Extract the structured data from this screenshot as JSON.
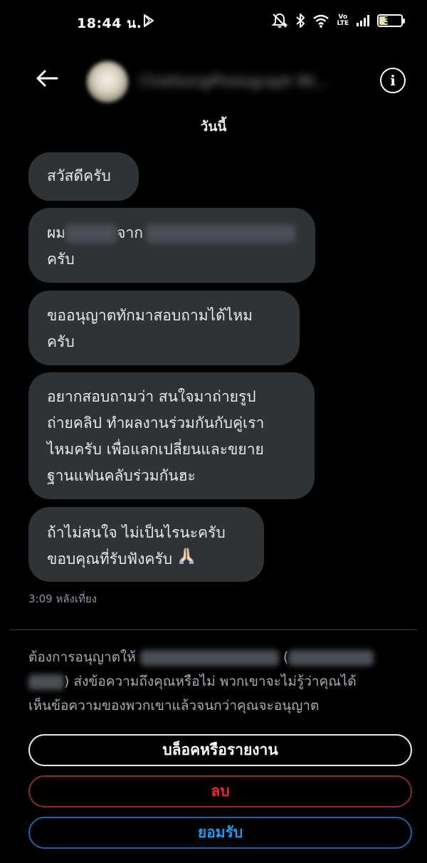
{
  "status_bar": {
    "time": "18:44 น.",
    "volte_top": "Vo",
    "volte_bottom": "LTE",
    "battery_percent": "37",
    "battery_level": 0.37,
    "icons": [
      "play-store-icon",
      "mute-icon",
      "bluetooth-icon",
      "wifi-icon",
      "volte-icon",
      "signal-icon",
      "battery-icon"
    ]
  },
  "header": {
    "back_icon": "arrow-left-icon",
    "contact_name": "ChiefsongPhotograph Wi...",
    "info_icon": "info-icon",
    "info_glyph": "i"
  },
  "date_label": "วันนี้",
  "messages": [
    {
      "lines": [
        "สวัสดีครับ"
      ]
    },
    {
      "line1_a": "ผม",
      "line1_b": "จาก",
      "line2": "ครับ"
    },
    {
      "lines": [
        "ขออนุญาตทักมาสอบถามได้ไหม",
        "ครับ"
      ]
    },
    {
      "lines": [
        "อยากสอบถามว่า สนใจมาถ่ายรูป",
        "ถ่ายคลิป ทำผลงานร่วมกันกับคู่เรา",
        "ไหมครับ เพื่อแลกเปลี่ยนและขยาย",
        "ฐานแฟนคลับร่วมกันฮะ"
      ]
    },
    {
      "lines": [
        "ถ้าไม่สนใจ ไม่เป็นไรนะครับ",
        "ขอบคุณที่รับฟังครับ"
      ],
      "emoji": "🙏🏻"
    }
  ],
  "timestamp": "3:09 หลังเที่ยง",
  "request": {
    "prefix": "ต้องการอนุญาตให้",
    "paren_open": "(",
    "paren_close": ")",
    "line2_rest": "ส่งข้อความถึงคุณหรือไม่ พวกเขาจะไม่รู้ว่าคุณได้",
    "line3": "เห็นข้อความของพวกเขาแล้วจนกว่าคุณจะอนุญาต"
  },
  "buttons": {
    "block_report": "บล็อคหรือรายงาน",
    "delete": "ลบ",
    "accept": "ยอมรับ"
  },
  "colors": {
    "background": "#000000",
    "bubble": "#2f3336",
    "danger": "#f4212e",
    "accent": "#1d9bf0"
  }
}
